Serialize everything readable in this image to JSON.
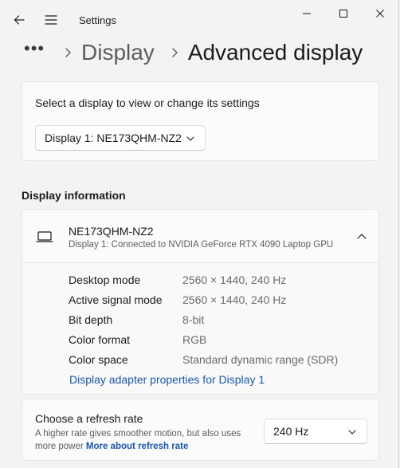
{
  "app": {
    "title": "Settings"
  },
  "breadcrumb": {
    "more": "•••",
    "parent": "Display",
    "current": "Advanced display"
  },
  "select_display": {
    "label": "Select a display to view or change its settings",
    "selected": "Display 1: NE173QHM-NZ2"
  },
  "display_information": {
    "section_title": "Display information",
    "monitor_name": "NE173QHM-NZ2",
    "connection": "Display 1: Connected to NVIDIA GeForce RTX 4090 Laptop GPU",
    "rows": [
      {
        "label": "Desktop mode",
        "value": "2560 × 1440, 240 Hz"
      },
      {
        "label": "Active signal mode",
        "value": "2560 × 1440, 240 Hz"
      },
      {
        "label": "Bit depth",
        "value": "8-bit"
      },
      {
        "label": "Color format",
        "value": "RGB"
      },
      {
        "label": "Color space",
        "value": "Standard dynamic range (SDR)"
      }
    ],
    "adapter_link": "Display adapter properties for Display 1"
  },
  "refresh_rate": {
    "title": "Choose a refresh rate",
    "description": "A higher rate gives smoother motion, but also uses more power",
    "link": "More about refresh rate",
    "selected": "240 Hz"
  },
  "icons": {
    "back": "back-arrow-icon",
    "menu": "hamburger-menu-icon",
    "minimize": "minimize-icon",
    "maximize": "maximize-icon",
    "close": "close-icon",
    "monitor": "monitor-icon",
    "chevron_up": "chevron-up-icon",
    "chevron_down": "chevron-down-icon",
    "chevron_right": "chevron-right-icon"
  },
  "colors": {
    "background": "#f3f3f3",
    "card": "#fbfbfb",
    "link": "#1a56a8",
    "secondary_text": "#5d5d5d"
  }
}
